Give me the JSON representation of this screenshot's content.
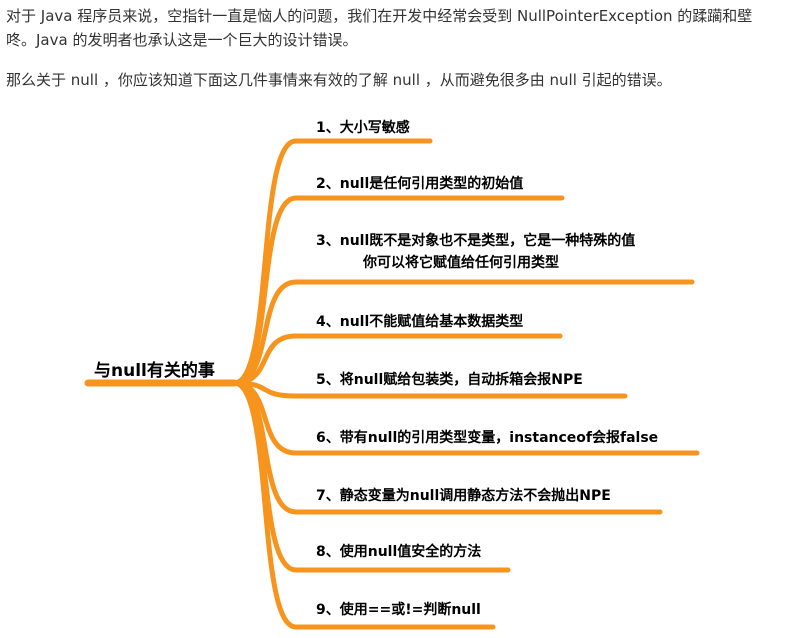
{
  "intro": {
    "paragraph1": "对于 Java 程序员来说，空指针一直是恼人的问题，我们在开发中经常会受到 NullPointerException 的蹂躏和壁咚。Java 的发明者也承认这是一个巨大的设计错误。",
    "paragraph2": "那么关于 null ，你应该知道下面这几件事情来有效的了解 null ，从而避免很多由 null 引起的错误。"
  },
  "mindmap": {
    "root": "与null有关的事",
    "branch_color": "#f7941d",
    "branches": [
      {
        "label": "1、大小写敏感"
      },
      {
        "label": "2、null是任何引用类型的初始值"
      },
      {
        "label": "3、null既不是对象也不是类型，它是一种特殊的值",
        "label2": "你可以将它赋值给任何引用类型"
      },
      {
        "label": "4、null不能赋值给基本数据类型"
      },
      {
        "label": "5、将null赋给包装类，自动拆箱会报NPE"
      },
      {
        "label": "6、带有null的引用类型变量，instanceof会报false"
      },
      {
        "label": "7、静态变量为null调用静态方法不会抛出NPE"
      },
      {
        "label": "8、使用null值安全的方法"
      },
      {
        "label": "9、使用==或!=判断null"
      }
    ]
  }
}
